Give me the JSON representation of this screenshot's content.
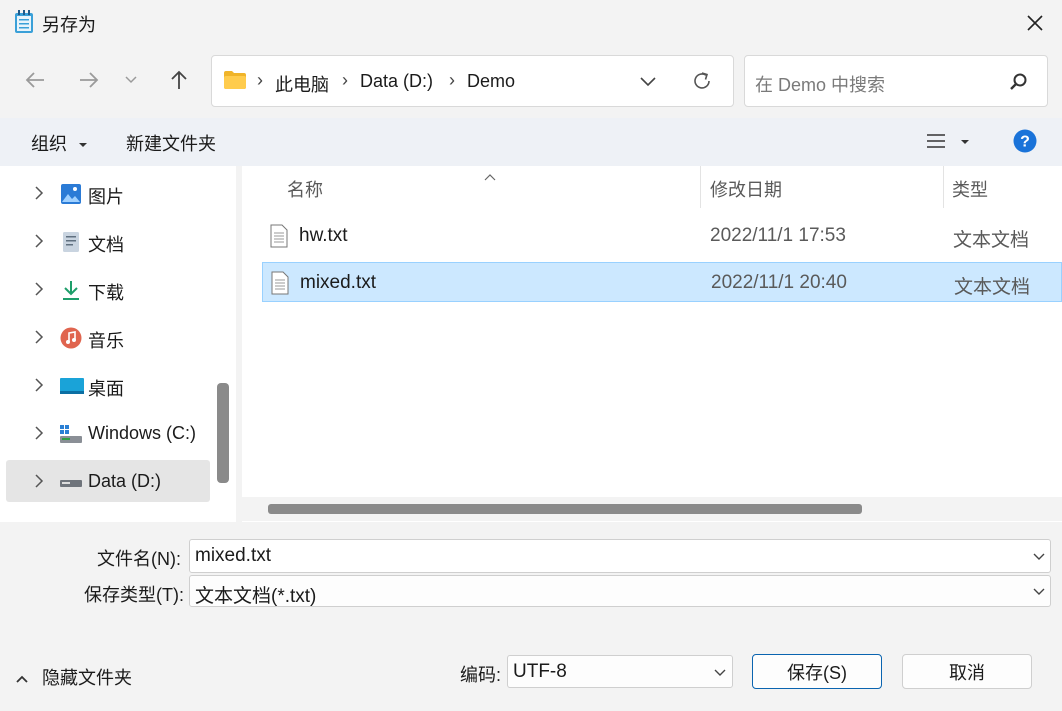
{
  "window": {
    "title": "另存为"
  },
  "nav": {
    "breadcrumb": [
      "此电脑",
      "Data (D:)",
      "Demo"
    ],
    "search_placeholder": "在 Demo 中搜索"
  },
  "toolbar": {
    "organize": "组织",
    "new_folder": "新建文件夹"
  },
  "sidebar": {
    "items": [
      {
        "label": "图片",
        "icon": "pictures-icon"
      },
      {
        "label": "文档",
        "icon": "documents-icon"
      },
      {
        "label": "下载",
        "icon": "downloads-icon"
      },
      {
        "label": "音乐",
        "icon": "music-icon"
      },
      {
        "label": "桌面",
        "icon": "desktop-icon"
      },
      {
        "label": "Windows (C:)",
        "icon": "drive-c-icon"
      },
      {
        "label": "Data (D:)",
        "icon": "drive-d-icon",
        "selected": true
      }
    ]
  },
  "filelist": {
    "columns": {
      "name": "名称",
      "modified": "修改日期",
      "type": "类型"
    },
    "rows": [
      {
        "name": "hw.txt",
        "modified": "2022/11/1 17:53",
        "type": "文本文档",
        "selected": false
      },
      {
        "name": "mixed.txt",
        "modified": "2022/11/1 20:40",
        "type": "文本文档",
        "selected": true
      }
    ]
  },
  "form": {
    "filename_label": "文件名(N):",
    "filename_value": "mixed.txt",
    "filetype_label": "保存类型(T):",
    "filetype_value": "文本文档(*.txt)",
    "hide_folders": "隐藏文件夹",
    "encoding_label": "编码:",
    "encoding_value": "UTF-8",
    "save": "保存(S)",
    "cancel": "取消"
  },
  "colors": {
    "accent": "#0067c0",
    "selected_row": "#cce8ff",
    "help": "#1a73d9"
  }
}
